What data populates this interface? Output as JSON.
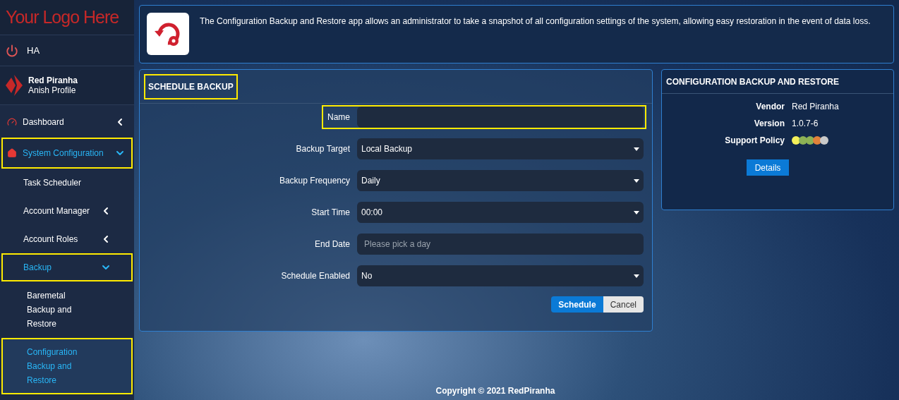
{
  "sidebar": {
    "logo": "Your Logo Here",
    "power_item": "HA",
    "profile": {
      "name": "Red Piranha",
      "subtitle": "Anish Profile"
    },
    "nav": [
      {
        "label": "Dashboard",
        "kind": "group",
        "expanded": false,
        "selected": false,
        "highlighted": false
      },
      {
        "label": "System Configuration",
        "kind": "group",
        "expanded": true,
        "selected": true,
        "highlighted": true,
        "children": [
          {
            "label": "Task Scheduler",
            "kind": "leaf",
            "selected": false,
            "highlighted": false
          },
          {
            "label": "Account Manager",
            "kind": "group",
            "expanded": false,
            "selected": false,
            "highlighted": false
          },
          {
            "label": "Account Roles",
            "kind": "group",
            "expanded": false,
            "selected": false,
            "highlighted": false
          },
          {
            "label": "Backup",
            "kind": "group",
            "expanded": true,
            "selected": true,
            "highlighted": true,
            "children": [
              {
                "label": "Baremetal Backup and Restore",
                "kind": "leaf",
                "selected": false,
                "highlighted": false
              },
              {
                "label": "Configuration Backup and Restore",
                "kind": "leaf",
                "selected": true,
                "highlighted": true
              }
            ]
          }
        ]
      }
    ]
  },
  "banner": {
    "description": "The Configuration Backup and Restore app allows an administrator to take a snapshot of all configuration settings of the system, allowing easy restoration in the event of data loss."
  },
  "schedule_panel": {
    "title": "SCHEDULE BACKUP",
    "title_highlighted": true,
    "fields": [
      {
        "label": "Name",
        "kind": "text",
        "highlighted": true
      },
      {
        "label": "Backup Target",
        "kind": "select",
        "value": "Local Backup",
        "highlighted": false
      },
      {
        "label": "Backup Frequency",
        "kind": "select",
        "value": "Daily",
        "highlighted": false
      },
      {
        "label": "Start Time",
        "kind": "select",
        "value": "00:00",
        "highlighted": false
      },
      {
        "label": "End Date",
        "kind": "date",
        "placeholder": "Please pick a day",
        "highlighted": false
      },
      {
        "label": "Schedule Enabled",
        "kind": "select",
        "value": "No",
        "highlighted": false
      }
    ],
    "buttons": [
      {
        "label": "Schedule",
        "kind": "primary"
      },
      {
        "label": "Cancel",
        "kind": "secondary"
      }
    ]
  },
  "info_panel": {
    "title": "CONFIGURATION BACKUP AND RESTORE",
    "rows": [
      {
        "label": "Vendor",
        "value": "Red Piranha"
      },
      {
        "label": "Version",
        "value": "1.0.7-6"
      }
    ],
    "support_policy": {
      "label": "Support Policy",
      "dots": [
        {
          "color": "#f4f05a"
        },
        {
          "color": "#8db255"
        },
        {
          "color": "#8db255"
        },
        {
          "color": "#e2823a"
        },
        {
          "color": "#c9c9c9"
        }
      ]
    },
    "button": "Details"
  },
  "footer": {
    "copyright": "Copyright © 2021 RedPiranha"
  }
}
